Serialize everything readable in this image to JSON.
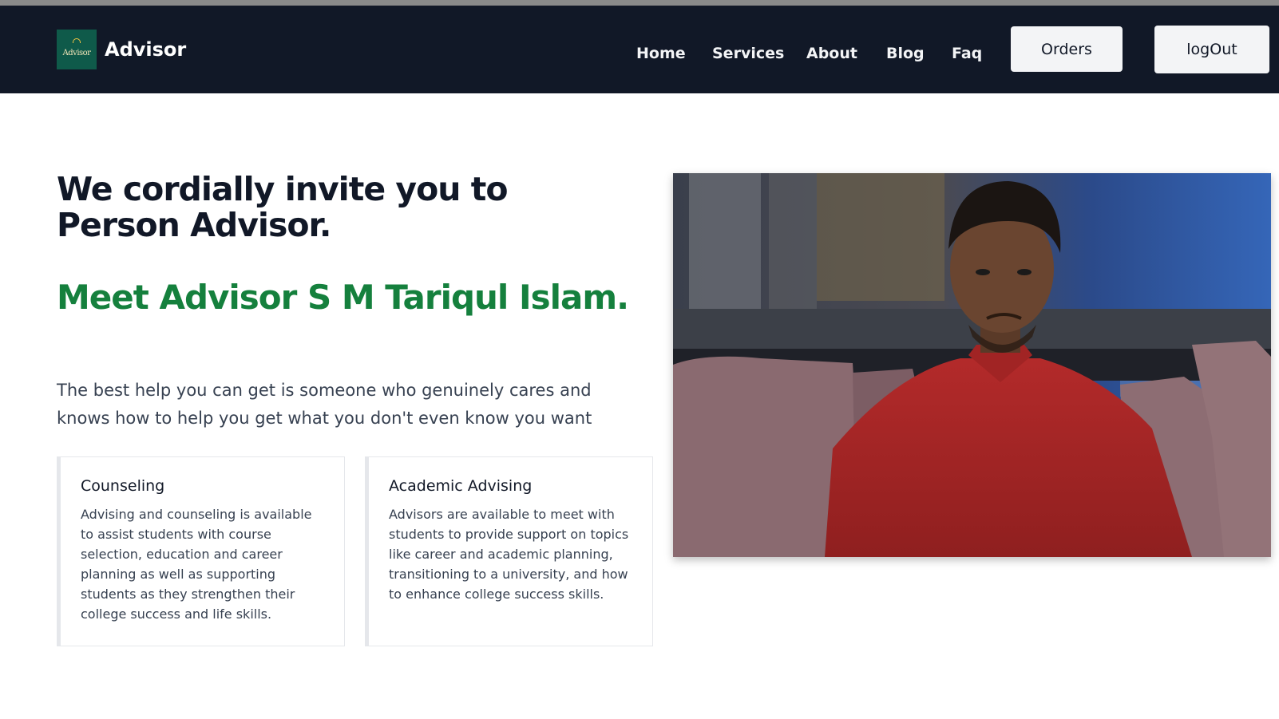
{
  "brand": {
    "logo_text": "Advisor",
    "name": "Advisor"
  },
  "nav": {
    "links": [
      "Home",
      "Services",
      "About",
      "Blog",
      "Faq"
    ],
    "orders_label": "Orders",
    "logout_label": "logOut"
  },
  "hero": {
    "title_line1": "We cordially invite you to",
    "title_line2": "Person Advisor.",
    "subtitle": "Meet Advisor S M Tariqul Islam.",
    "description": "The best help you can get is someone who genuinely cares and knows how to help you get what you don't even know you want"
  },
  "cards": [
    {
      "title": "Counseling",
      "body": "Advising and counseling is available to assist students with course selection, education and career planning as well as supporting students as they strengthen their college success and life skills."
    },
    {
      "title": "Academic Advising",
      "body": "Advisors are available to meet with students to provide support on topics like career and academic planning, transitioning to a university, and how to enhance college success skills."
    }
  ],
  "colors": {
    "navbar_bg": "#111827",
    "accent_green": "#15803d",
    "button_bg": "#f3f4f6"
  }
}
